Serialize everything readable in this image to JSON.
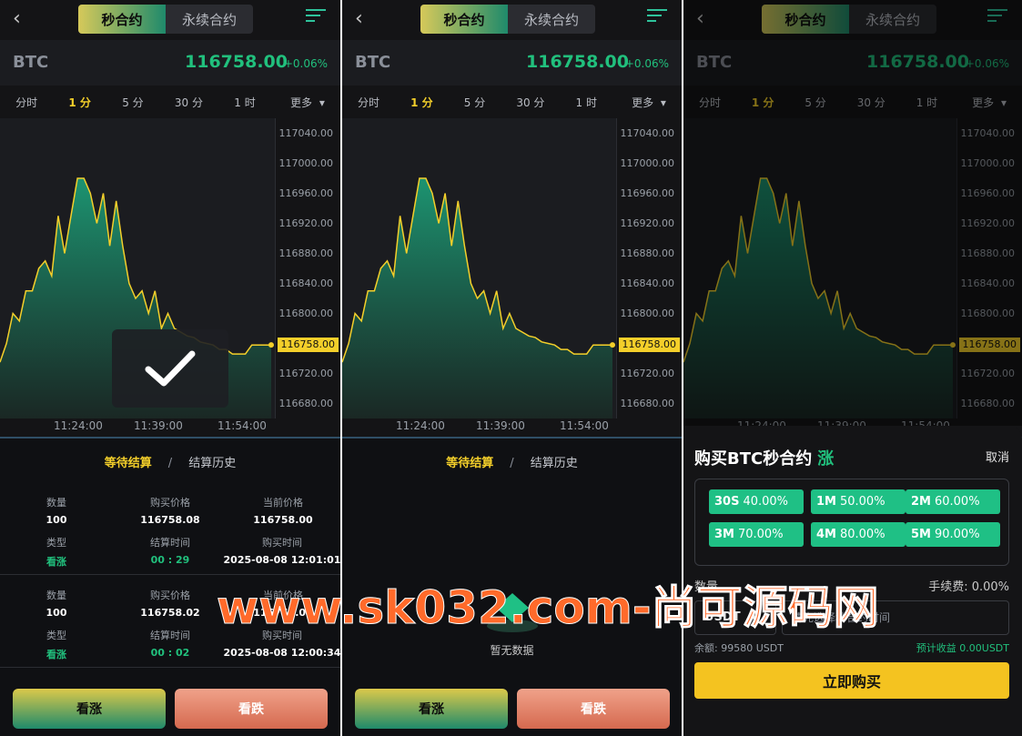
{
  "header": {
    "tab_second": "秒合约",
    "tab_perpetual": "永续合约"
  },
  "symbol": {
    "name": "BTC",
    "price": "116758.00",
    "change": "+0.06%"
  },
  "timeframes": [
    "分时",
    "1 分",
    "5 分",
    "30 分",
    "1 时",
    "更多"
  ],
  "axis": {
    "ticks": [
      "117040.00",
      "117000.00",
      "116960.00",
      "116920.00",
      "116880.00",
      "116840.00",
      "116800.00",
      "116720.00",
      "116680.00"
    ],
    "current": "116758.00",
    "times": [
      "11:24:00",
      "11:39:00",
      "11:54:00"
    ]
  },
  "chart_data": {
    "type": "area",
    "ylim": [
      116660,
      117060
    ],
    "values": [
      116735,
      116760,
      116800,
      116790,
      116830,
      116830,
      116860,
      116870,
      116850,
      116930,
      116880,
      116930,
      116980,
      116980,
      116960,
      116920,
      116960,
      116890,
      116950,
      116890,
      116840,
      116820,
      116830,
      116800,
      116830,
      116780,
      116800,
      116780,
      116775,
      116770,
      116768,
      116762,
      116760,
      116758,
      116752,
      116752,
      116746,
      116746,
      116746,
      116758,
      116758,
      116758,
      116758
    ]
  },
  "history_tabs": {
    "pending": "等待结算",
    "separator": "/",
    "history": "结算历史"
  },
  "orders": [
    {
      "qty_label": "数量",
      "qty": "100",
      "buy_price_label": "购买价格",
      "buy_price": "116758.08",
      "cur_price_label": "当前价格",
      "cur_price": "116758.00",
      "type_label": "类型",
      "type": "看涨",
      "settle_label": "结算时间",
      "settle": "00 : 29",
      "buy_time_label": "购买时间",
      "buy_time": "2025-08-08 12:01:01"
    },
    {
      "qty_label": "数量",
      "qty": "100",
      "buy_price_label": "购买价格",
      "buy_price": "116758.02",
      "cur_price_label": "当前价格",
      "cur_price": "116758.00",
      "type_label": "类型",
      "type": "看涨",
      "settle_label": "结算时间",
      "settle": "00 : 02",
      "buy_time_label": "购买时间",
      "buy_time": "2025-08-08 12:00:34"
    }
  ],
  "actions": {
    "up": "看涨",
    "down": "看跌"
  },
  "empty_text": "暂无数据",
  "modal": {
    "title": "购买BTC秒合约",
    "direction": "涨",
    "cancel": "取消",
    "periods": [
      {
        "t": "30S",
        "r": "40.00%"
      },
      {
        "t": "1M",
        "r": "50.00%"
      },
      {
        "t": "2M",
        "r": "60.00%"
      },
      {
        "t": "3M",
        "r": "70.00%"
      },
      {
        "t": "4M",
        "r": "80.00%"
      },
      {
        "t": "5M",
        "r": "90.00%"
      }
    ],
    "qty_label": "数量",
    "fee_label": "手续费: 0.00%",
    "currency": "USDT",
    "amount_placeholder": "请先选择秒合约时间",
    "balance": "余额: 99580 USDT",
    "estimate": "预计收益 0.00USDT",
    "buy_now": "立即购买"
  },
  "watermark": "www.sk032.com-尚可源码网",
  "colors": {
    "up": "#21c07d",
    "accent": "#f4cf2a",
    "line": "#f4cf2a"
  }
}
